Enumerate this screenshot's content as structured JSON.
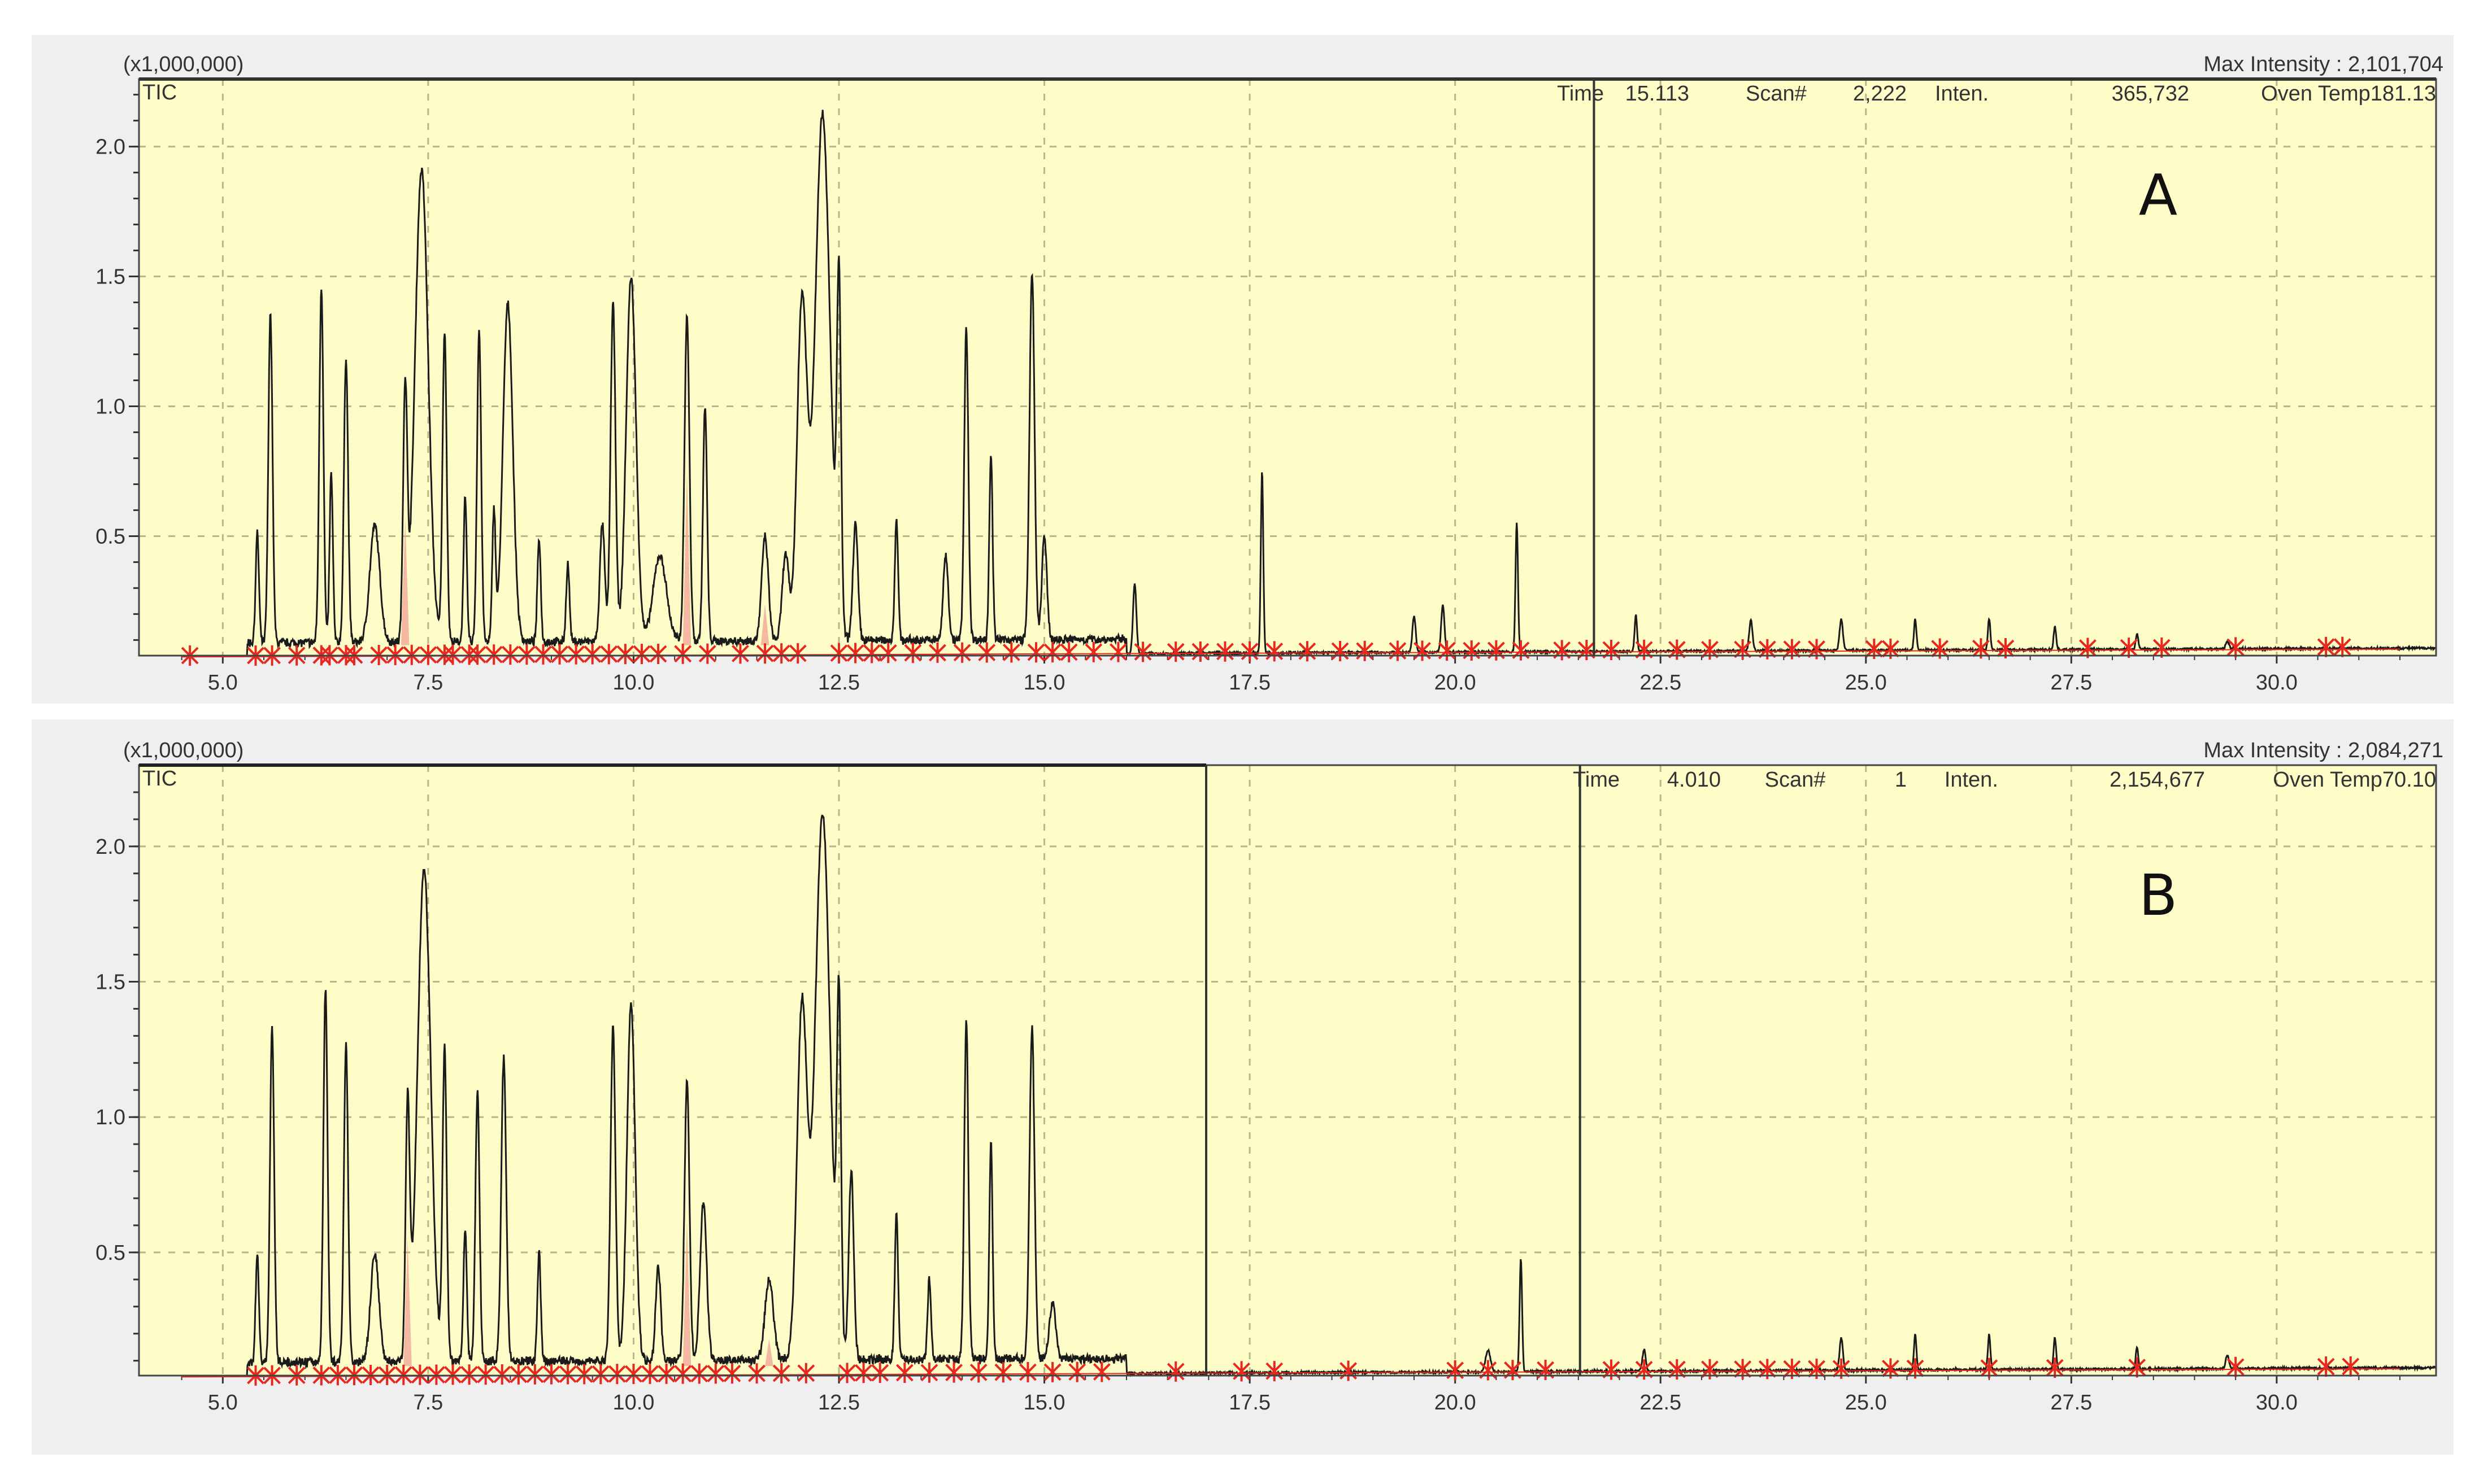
{
  "colors": {
    "panel_bg": "#efefef",
    "plot_bg": "#fefdc8",
    "grid": "#b9b68a",
    "trace": "#1a1a1a",
    "marker": "#e8281e",
    "fill": "#f2a79a"
  },
  "chart_data": [
    {
      "type": "line",
      "panel_label": "A",
      "series_label": "TIC",
      "y_multiplier_label": "(x1,000,000)",
      "max_intensity": "Max Intensity : 2,101,704",
      "info": {
        "time_label": "Time",
        "time": "15.113",
        "scan_label": "Scan#",
        "scan": "2,222",
        "inten_label": "Inten.",
        "inten": "365,732",
        "oven": "Oven Temp181.13"
      },
      "xlim": [
        3.98,
        31.94
      ],
      "ylim": [
        0.04,
        2.26
      ],
      "x_ticks": [
        "5.0",
        "7.5",
        "10.0",
        "12.5",
        "15.0",
        "17.5",
        "20.0",
        "22.5",
        "25.0",
        "27.5",
        "30.0"
      ],
      "y_ticks": [
        "0.5",
        "1.0",
        "1.5",
        "2.0"
      ],
      "cursor_times": [
        21.69
      ],
      "box_end_time": null,
      "baseline": [
        0.03,
        0.065
      ],
      "peaks": [
        [
          5.42,
          0.42,
          0.02
        ],
        [
          5.58,
          1.27,
          0.025
        ],
        [
          6.2,
          1.37,
          0.025
        ],
        [
          6.32,
          0.65,
          0.02
        ],
        [
          6.5,
          1.1,
          0.025
        ],
        [
          6.85,
          0.45,
          0.06
        ],
        [
          7.22,
          0.95,
          0.025
        ],
        [
          7.42,
          1.82,
          0.08
        ],
        [
          7.7,
          1.2,
          0.025
        ],
        [
          7.95,
          0.55,
          0.02
        ],
        [
          8.12,
          1.2,
          0.025
        ],
        [
          8.3,
          0.5,
          0.02
        ],
        [
          8.47,
          1.3,
          0.06
        ],
        [
          8.85,
          0.4,
          0.02
        ],
        [
          9.2,
          0.3,
          0.02
        ],
        [
          9.62,
          0.45,
          0.03
        ],
        [
          9.75,
          1.3,
          0.03
        ],
        [
          9.97,
          1.4,
          0.06
        ],
        [
          10.32,
          0.33,
          0.08
        ],
        [
          10.65,
          1.25,
          0.03
        ],
        [
          10.87,
          0.9,
          0.025
        ],
        [
          11.6,
          0.4,
          0.04
        ],
        [
          11.85,
          0.33,
          0.04
        ],
        [
          12.05,
          1.3,
          0.06
        ],
        [
          12.3,
          2.03,
          0.09
        ],
        [
          12.5,
          1.3,
          0.025
        ],
        [
          12.7,
          0.45,
          0.03
        ],
        [
          13.2,
          0.47,
          0.02
        ],
        [
          13.8,
          0.33,
          0.03
        ],
        [
          14.05,
          1.2,
          0.025
        ],
        [
          14.35,
          0.72,
          0.02
        ],
        [
          14.85,
          1.42,
          0.03
        ],
        [
          15.0,
          0.4,
          0.03
        ],
        [
          16.1,
          0.27,
          0.02
        ],
        [
          17.65,
          0.7,
          0.015
        ],
        [
          19.5,
          0.14,
          0.02
        ],
        [
          19.85,
          0.18,
          0.02
        ],
        [
          20.75,
          0.5,
          0.015
        ],
        [
          22.2,
          0.14,
          0.015
        ],
        [
          23.6,
          0.12,
          0.02
        ],
        [
          24.7,
          0.12,
          0.02
        ],
        [
          25.6,
          0.12,
          0.015
        ],
        [
          26.5,
          0.12,
          0.015
        ],
        [
          27.3,
          0.09,
          0.015
        ],
        [
          28.3,
          0.06,
          0.015
        ],
        [
          29.4,
          0.03,
          0.02
        ]
      ],
      "marker_times": [
        4.6,
        5.4,
        5.6,
        5.9,
        6.2,
        6.3,
        6.5,
        6.6,
        6.9,
        7.1,
        7.3,
        7.5,
        7.7,
        7.8,
        8.0,
        8.1,
        8.3,
        8.5,
        8.7,
        8.9,
        9.1,
        9.3,
        9.5,
        9.7,
        9.9,
        10.1,
        10.3,
        10.6,
        10.9,
        11.3,
        11.6,
        11.8,
        12.0,
        12.5,
        12.7,
        12.9,
        13.1,
        13.4,
        13.7,
        14.0,
        14.3,
        14.6,
        14.9,
        15.1,
        15.3,
        15.6,
        15.9,
        16.2,
        16.6,
        16.9,
        17.2,
        17.5,
        17.8,
        18.2,
        18.6,
        18.9,
        19.3,
        19.6,
        19.9,
        20.2,
        20.5,
        20.8,
        21.3,
        21.6,
        21.9,
        22.3,
        22.7,
        23.1,
        23.5,
        23.8,
        24.1,
        24.4,
        25.1,
        25.3,
        25.9,
        26.4,
        26.7,
        27.7,
        28.2,
        28.6,
        29.5,
        30.6,
        30.8
      ]
    },
    {
      "type": "line",
      "panel_label": "B",
      "series_label": "TIC",
      "y_multiplier_label": "(x1,000,000)",
      "max_intensity": "Max Intensity : 2,084,271",
      "info": {
        "time_label": "Time",
        "time": "4.010",
        "scan_label": "Scan#",
        "scan": "1",
        "inten_label": "Inten.",
        "inten": "2,154,677",
        "oven": "Oven Temp70.10"
      },
      "xlim": [
        3.98,
        31.94
      ],
      "ylim": [
        0.045,
        2.3
      ],
      "x_ticks": [
        "5.0",
        "7.5",
        "10.0",
        "12.5",
        "15.0",
        "17.5",
        "20.0",
        "22.5",
        "25.0",
        "27.5",
        "30.0"
      ],
      "y_ticks": [
        "0.5",
        "1.0",
        "1.5",
        "2.0"
      ],
      "cursor_times": [
        16.97,
        21.52
      ],
      "box_end_time": 16.97,
      "baseline": [
        0.035,
        0.07
      ],
      "peaks": [
        [
          5.42,
          0.4,
          0.02
        ],
        [
          5.6,
          1.24,
          0.025
        ],
        [
          6.25,
          1.38,
          0.025
        ],
        [
          6.5,
          1.18,
          0.025
        ],
        [
          6.85,
          0.4,
          0.05
        ],
        [
          7.25,
          0.92,
          0.025
        ],
        [
          7.45,
          1.82,
          0.08
        ],
        [
          7.7,
          1.15,
          0.025
        ],
        [
          7.95,
          0.5,
          0.02
        ],
        [
          8.1,
          1.0,
          0.025
        ],
        [
          8.42,
          1.12,
          0.03
        ],
        [
          8.85,
          0.4,
          0.02
        ],
        [
          9.75,
          1.23,
          0.03
        ],
        [
          9.97,
          1.32,
          0.05
        ],
        [
          10.3,
          0.35,
          0.03
        ],
        [
          10.65,
          1.03,
          0.03
        ],
        [
          10.85,
          0.58,
          0.04
        ],
        [
          11.65,
          0.3,
          0.05
        ],
        [
          12.05,
          1.3,
          0.06
        ],
        [
          12.3,
          2.02,
          0.09
        ],
        [
          12.5,
          1.25,
          0.025
        ],
        [
          12.65,
          0.7,
          0.03
        ],
        [
          13.2,
          0.55,
          0.02
        ],
        [
          13.6,
          0.3,
          0.02
        ],
        [
          14.05,
          1.25,
          0.025
        ],
        [
          14.35,
          0.8,
          0.02
        ],
        [
          14.85,
          1.22,
          0.03
        ],
        [
          15.1,
          0.2,
          0.04
        ],
        [
          20.8,
          0.42,
          0.015
        ],
        [
          20.4,
          0.08,
          0.03
        ],
        [
          22.3,
          0.08,
          0.02
        ],
        [
          24.7,
          0.12,
          0.02
        ],
        [
          25.6,
          0.13,
          0.015
        ],
        [
          26.5,
          0.13,
          0.015
        ],
        [
          27.3,
          0.12,
          0.015
        ],
        [
          28.3,
          0.08,
          0.015
        ],
        [
          29.4,
          0.05,
          0.02
        ]
      ],
      "marker_times": [
        5.4,
        5.6,
        5.9,
        6.2,
        6.4,
        6.6,
        6.8,
        7.0,
        7.2,
        7.4,
        7.6,
        7.8,
        8.0,
        8.2,
        8.4,
        8.6,
        8.8,
        9.0,
        9.2,
        9.4,
        9.6,
        9.8,
        10.0,
        10.2,
        10.4,
        10.6,
        10.8,
        11.0,
        11.2,
        11.5,
        11.8,
        12.1,
        12.6,
        12.8,
        13.0,
        13.3,
        13.6,
        13.9,
        14.2,
        14.5,
        14.8,
        15.1,
        15.4,
        15.7,
        16.6,
        17.4,
        17.8,
        18.7,
        20.0,
        20.4,
        20.7,
        21.1,
        21.9,
        22.3,
        22.7,
        23.1,
        23.5,
        23.8,
        24.1,
        24.4,
        24.7,
        25.3,
        25.6,
        26.5,
        27.3,
        28.3,
        29.5,
        30.6,
        30.9
      ]
    }
  ]
}
